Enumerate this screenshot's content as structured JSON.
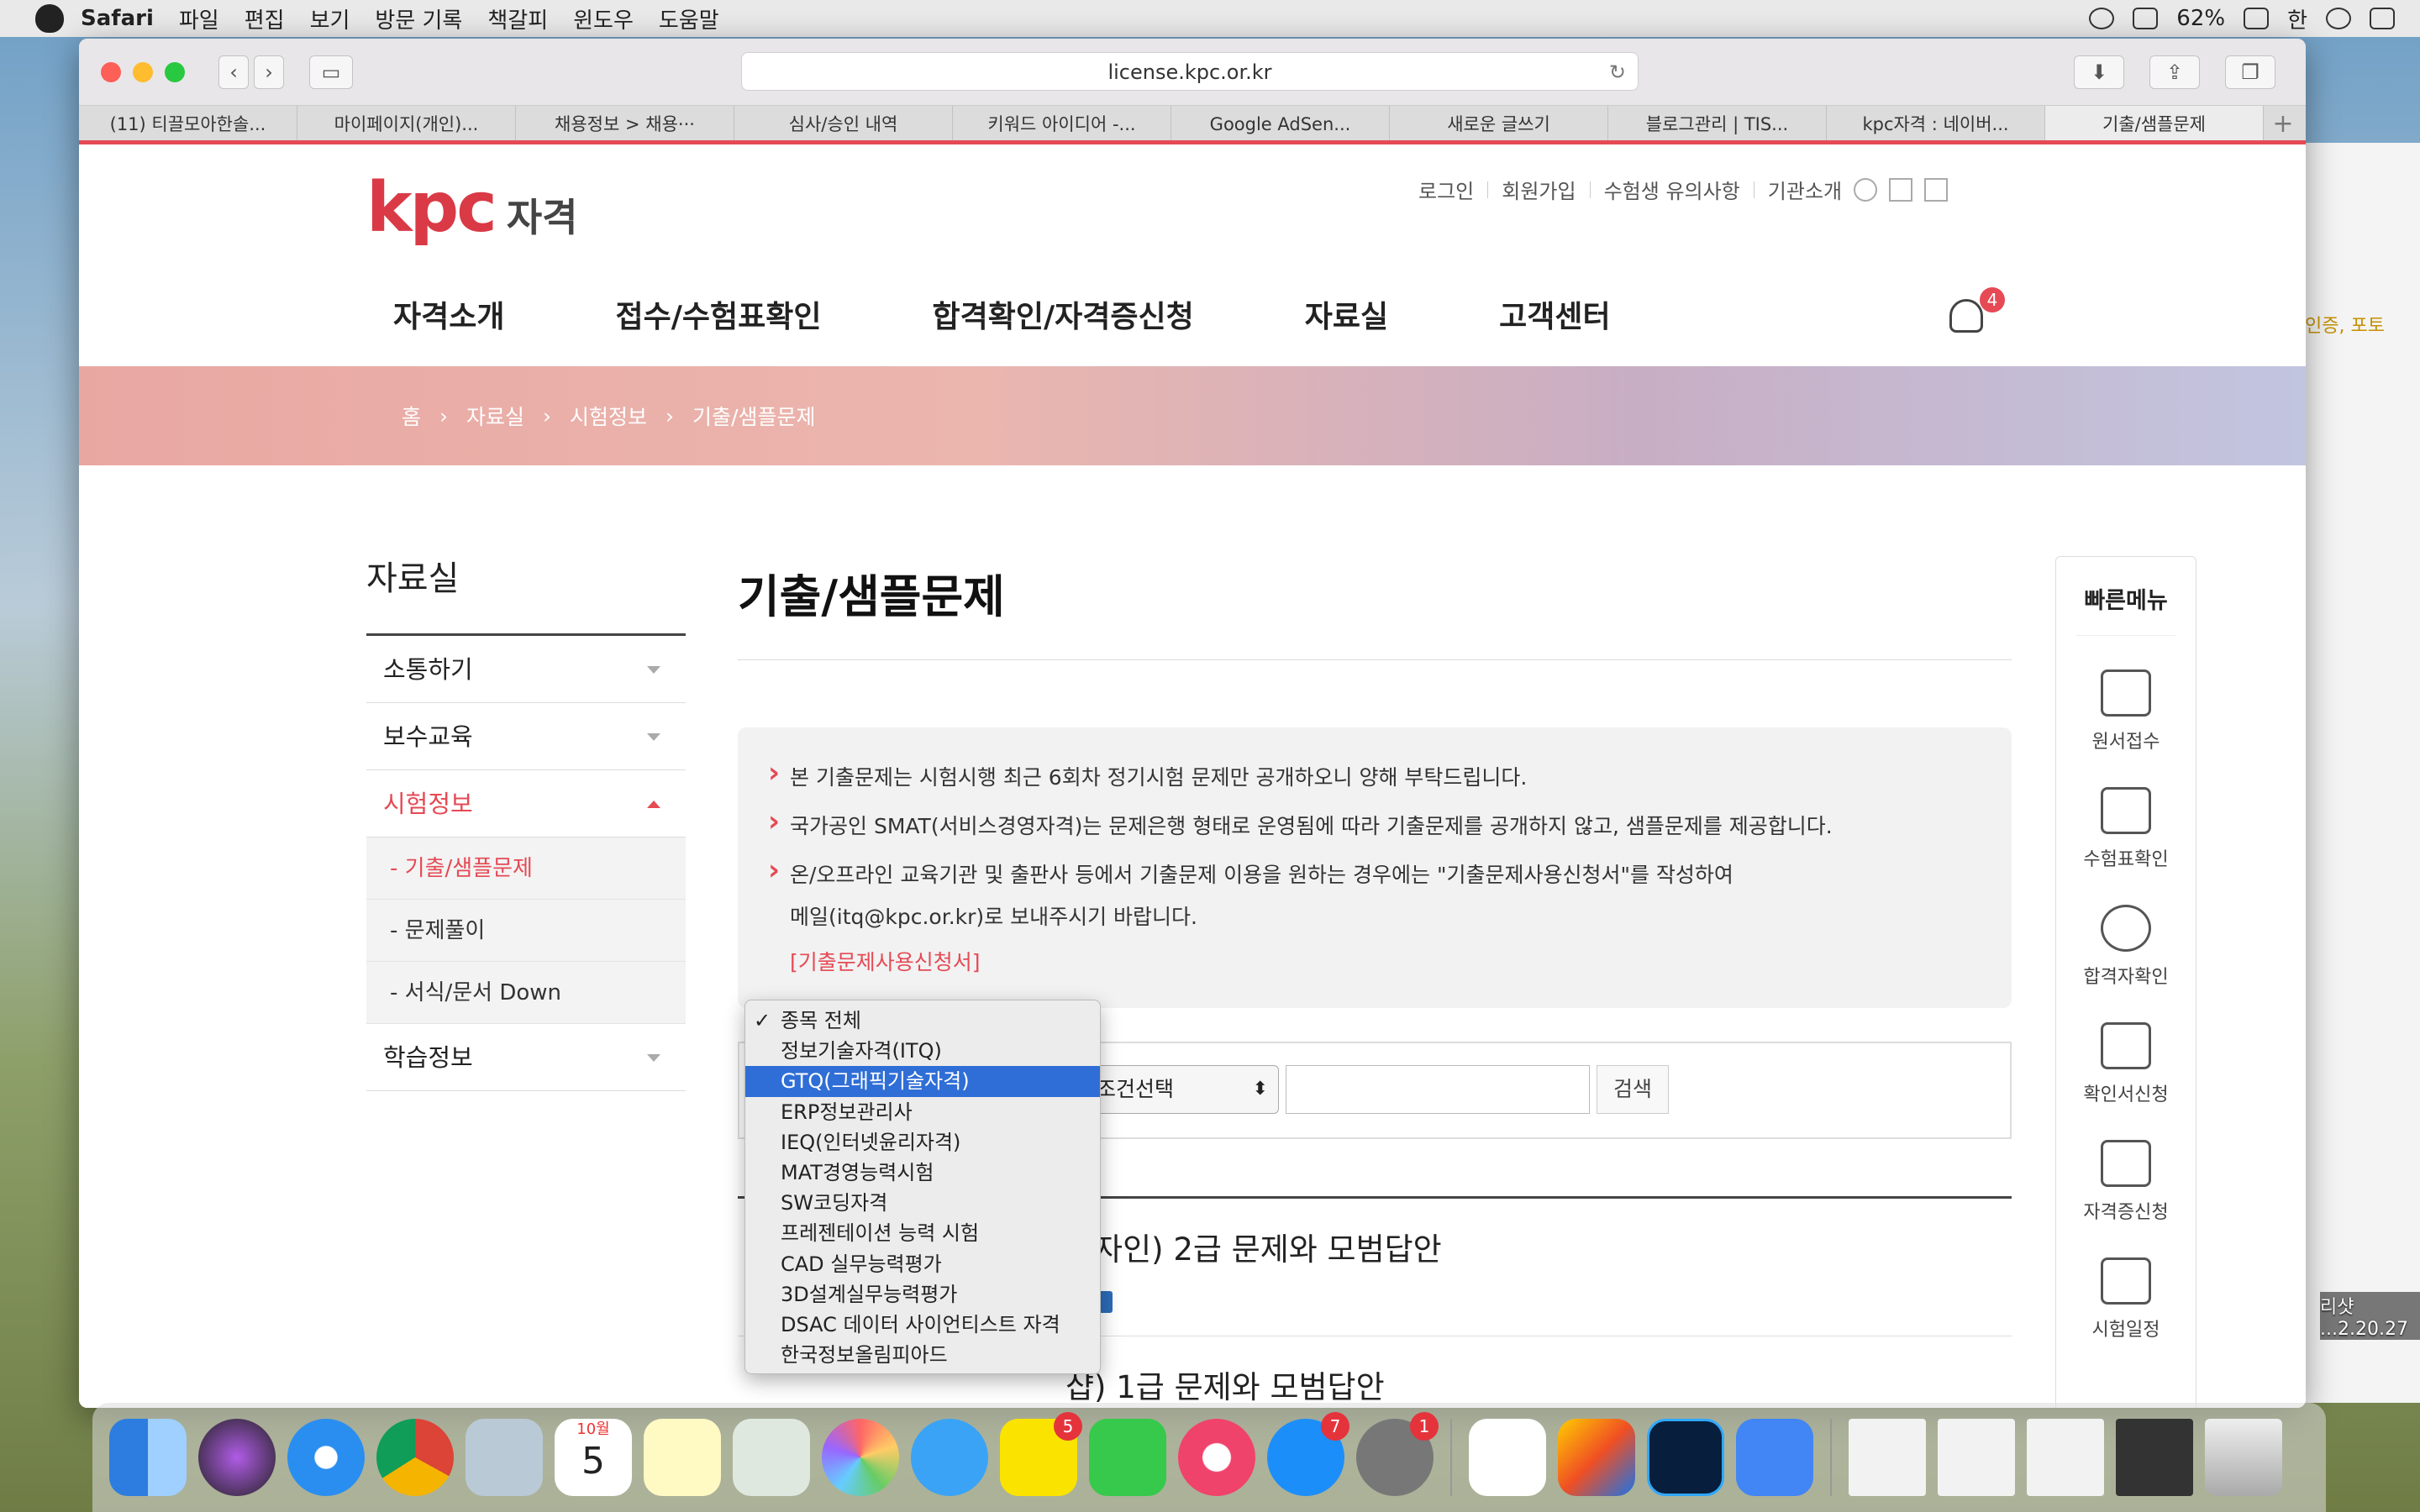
{
  "menubar": {
    "app": "Safari",
    "items": [
      "파일",
      "편집",
      "보기",
      "방문 기록",
      "책갈피",
      "윈도우",
      "도움말"
    ],
    "battery": "62%",
    "input": "한"
  },
  "browser": {
    "url": "license.kpc.or.kr",
    "tabs": [
      "(11) 티끌모아한솔...",
      "마이페이지(개인)...",
      "채용정보 > 채용···",
      "심사/승인 내역",
      "키워드 아이디어 -...",
      "Google AdSen...",
      "새로운 글쓰기",
      "블로그관리 | TIS...",
      "kpc자격 : 네이버...",
      "기출/샘플문제"
    ]
  },
  "site": {
    "logo_mark": "kpc",
    "logo_text": "자격",
    "util": [
      "로그인",
      "회원가입",
      "수험생 유의사항",
      "기관소개"
    ],
    "gnb": [
      "자격소개",
      "접수/수험표확인",
      "합격확인/자격증신청",
      "자료실",
      "고객센터"
    ],
    "notif_count": "4",
    "breadcrumb": [
      "홈",
      "자료실",
      "시험정보",
      "기출/샘플문제"
    ],
    "lnb": {
      "title": "자료실",
      "items": [
        "소통하기",
        "보수교육",
        "시험정보",
        "학습정보"
      ],
      "subs": [
        "- 기출/샘플문제",
        "- 문제풀이",
        "- 서식/문서 Down"
      ]
    },
    "page_title": "기출/샘플문제",
    "notice": [
      "본 기출문제는 시험시행 최근 6회차 정기시험 문제만 공개하오니 양해 부탁드립니다.",
      "국가공인 SMAT(서비스경영자격)는 문제은행 형태로 운영됨에 따라 기출문제를 공개하지 않고, 샘플문제를 제공합니다.",
      "온/오프라인 교육기관 및 출판사 등에서 기출문제 이용을 원하는 경우에는 \"기출문제사용신청서\"를 작성하여",
      "메일(itq@kpc.or.kr)로 보내주시기 바랍니다.",
      "[기출문제사용신청서]"
    ],
    "search": {
      "condition": "조건선택",
      "button": "검색",
      "input_value": ""
    },
    "results": [
      "디자인) 2급 문제와 모범답안",
      "샵) 1급 문제와 모범답안"
    ],
    "dropdown": {
      "checkmark": "✓",
      "selected_index": 0,
      "highlight_index": 2,
      "options": [
        "종목 전체",
        "정보기술자격(ITQ)",
        "GTQ(그래픽기술자격)",
        "ERP정보관리사",
        "IEQ(인터넷윤리자격)",
        "MAT경영능력시험",
        "SW코딩자격",
        "프레젠테이션 능력 시험",
        "CAD 실무능력평가",
        "3D설계실무능력평가",
        "DSAC 데이터 사이언티스트 자격",
        "한국정보올림피아드"
      ]
    },
    "quick": {
      "title": "빠른메뉴",
      "items": [
        "원서접수",
        "수험표확인",
        "합격자확인",
        "확인서신청",
        "자격증신청",
        "시험일정"
      ]
    }
  },
  "desktop": {
    "side_links": "인증, 포토",
    "screenshot_label": "리샷\n...2.20.27"
  },
  "dock": {
    "calendar_month": "10월",
    "calendar_day": "5",
    "badges": {
      "talk": "5",
      "appstore": "7",
      "prefs": "1"
    }
  }
}
